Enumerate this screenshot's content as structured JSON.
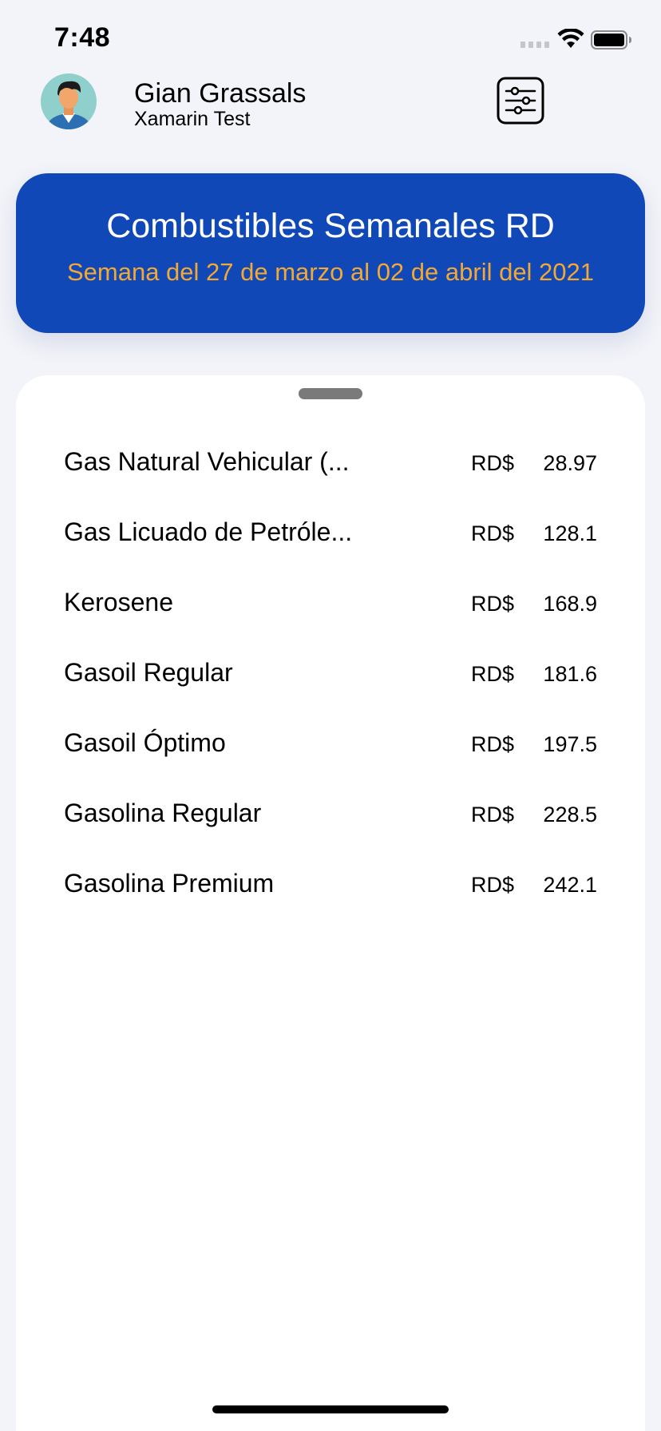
{
  "status_bar": {
    "time": "7:48",
    "icons": [
      "signal-icon",
      "wifi-icon",
      "battery-icon"
    ]
  },
  "header": {
    "user_name": "Gian Grassals",
    "subtitle": "Xamarin Test",
    "avatar_icon": "person-avatar-icon",
    "settings_icon": "sliders-icon"
  },
  "banner": {
    "title": "Combustibles Semanales RD",
    "subtitle": "Semana del 27 de marzo al 02 de abril del 2021",
    "background_color": "#1048b8",
    "subtitle_color": "#f3a833"
  },
  "fuel_list": {
    "items": [
      {
        "name": "Gas Natural Vehicular (...",
        "currency": "RD$",
        "price": "28.97"
      },
      {
        "name": "Gas Licuado de Petróle...",
        "currency": "RD$",
        "price": "128.1"
      },
      {
        "name": "Kerosene",
        "currency": "RD$",
        "price": "168.9"
      },
      {
        "name": "Gasoil Regular",
        "currency": "RD$",
        "price": "181.6"
      },
      {
        "name": "Gasoil Óptimo",
        "currency": "RD$",
        "price": "197.5"
      },
      {
        "name": "Gasolina Regular",
        "currency": "RD$",
        "price": "228.5"
      },
      {
        "name": "Gasolina Premium",
        "currency": "RD$",
        "price": "242.1"
      }
    ]
  }
}
